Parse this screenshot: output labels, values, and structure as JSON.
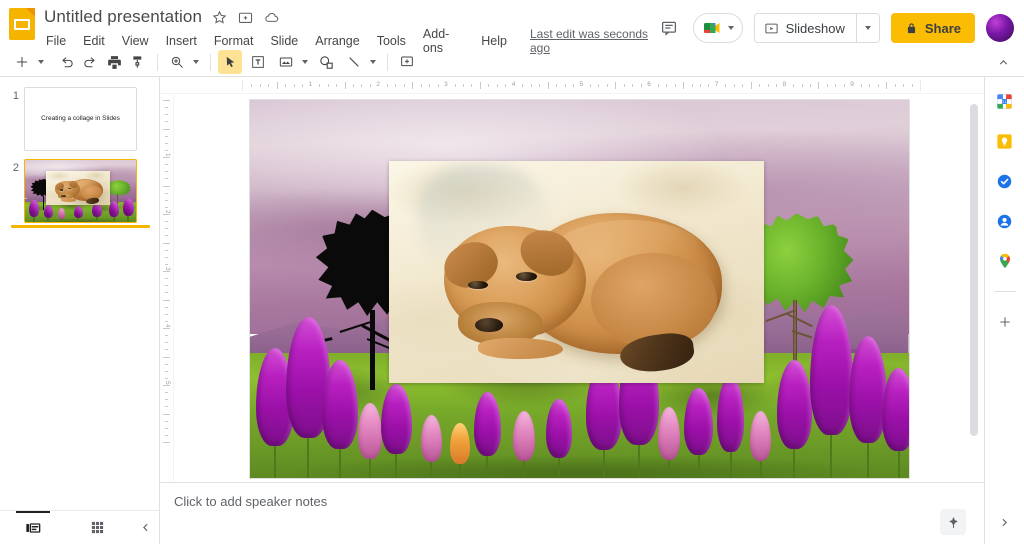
{
  "app": {
    "name": "Google Slides",
    "logo_icon": "slides-logo-icon",
    "accent_yellow": "#F4B400",
    "share_yellow": "#FBBC04"
  },
  "header": {
    "doc_title": "Untitled presentation",
    "star_icon": "star-icon",
    "move_icon": "move-to-folder-icon",
    "cloud_icon": "cloud-saved-icon",
    "menus": [
      {
        "label": "File"
      },
      {
        "label": "Edit"
      },
      {
        "label": "View"
      },
      {
        "label": "Insert"
      },
      {
        "label": "Format"
      },
      {
        "label": "Slide"
      },
      {
        "label": "Arrange"
      },
      {
        "label": "Tools"
      },
      {
        "label": "Add-ons"
      },
      {
        "label": "Help"
      }
    ],
    "last_edit": "Last edit was seconds ago",
    "comment_icon": "comment-history-icon",
    "meet_icon": "google-meet-icon",
    "slideshow_label": "Slideshow",
    "slideshow_icon": "present-icon",
    "slideshow_caret_icon": "chevron-down-icon",
    "share_label": "Share",
    "share_icon": "lock-icon",
    "avatar_name": "account-avatar"
  },
  "toolbar": {
    "items": [
      {
        "name": "new-slide-button",
        "icon": "plus-icon",
        "has_caret": true,
        "active": false
      },
      {
        "name": "undo-button",
        "icon": "undo-icon",
        "has_caret": false,
        "active": false
      },
      {
        "name": "redo-button",
        "icon": "redo-icon",
        "has_caret": false,
        "active": false
      },
      {
        "name": "print-button",
        "icon": "print-icon",
        "has_caret": false,
        "active": false
      },
      {
        "name": "paint-format-button",
        "icon": "paint-format-icon",
        "has_caret": false,
        "active": false
      },
      {
        "name": "zoom-button",
        "icon": "zoom-icon",
        "has_caret": true,
        "active": false
      },
      {
        "name": "select-tool-button",
        "icon": "cursor-arrow-icon",
        "has_caret": false,
        "active": true
      },
      {
        "name": "text-box-button",
        "icon": "text-box-icon",
        "has_caret": false,
        "active": false
      },
      {
        "name": "insert-image-button",
        "icon": "image-icon",
        "has_caret": true,
        "active": false
      },
      {
        "name": "shape-button",
        "icon": "shape-icon",
        "has_caret": false,
        "active": false
      },
      {
        "name": "line-button",
        "icon": "line-icon",
        "has_caret": true,
        "active": false
      },
      {
        "name": "comment-button",
        "icon": "add-comment-icon",
        "has_caret": false,
        "active": false
      }
    ],
    "collapse_icon": "chevron-up-icon"
  },
  "filmstrip": {
    "slides": [
      {
        "number": "1",
        "title": "Creating a collage in Slides",
        "type": "title-text",
        "selected": false
      },
      {
        "number": "2",
        "title": "",
        "type": "collage",
        "selected": true
      }
    ],
    "bottom": {
      "filmstrip_view_icon": "filmstrip-view-icon",
      "grid_view_icon": "grid-view-icon",
      "collapse_icon": "chevron-left-icon"
    }
  },
  "ruler": {
    "horizontal_labels": [
      "1",
      "2",
      "3",
      "4",
      "5",
      "6",
      "7",
      "8",
      "9"
    ],
    "vertical_labels": [
      "1",
      "2",
      "3",
      "4",
      "5"
    ],
    "unit": "inches"
  },
  "canvas": {
    "slide_number": "2",
    "description": "Photo collage: a lupine meadow landscape background with purple mountains and pink sky, a black silhouette tree at left, a green leafy tree at right, and a framed photo of a tan puppy curled up on sand layered on top.",
    "layers": [
      {
        "name": "background-landscape",
        "label": "Lupine meadow with purple sky and mountains"
      },
      {
        "name": "black-tree",
        "label": "Black silhouette tree"
      },
      {
        "name": "green-tree",
        "label": "Green leafy tree"
      },
      {
        "name": "puppy-photo",
        "label": "Tan puppy curled on sand"
      }
    ],
    "handle_dots_icon": "resize-handle-icon"
  },
  "notes": {
    "placeholder": "Click to add speaker notes",
    "explore_icon": "explore-icon"
  },
  "rail": {
    "items": [
      {
        "name": "google-calendar-icon",
        "label": "Calendar"
      },
      {
        "name": "google-keep-icon",
        "label": "Keep"
      },
      {
        "name": "google-tasks-icon",
        "label": "Tasks"
      },
      {
        "name": "google-contacts-icon",
        "label": "Contacts"
      },
      {
        "name": "google-maps-icon",
        "label": "Maps"
      }
    ],
    "add_label": "+",
    "expand_icon": "chevron-right-icon"
  }
}
